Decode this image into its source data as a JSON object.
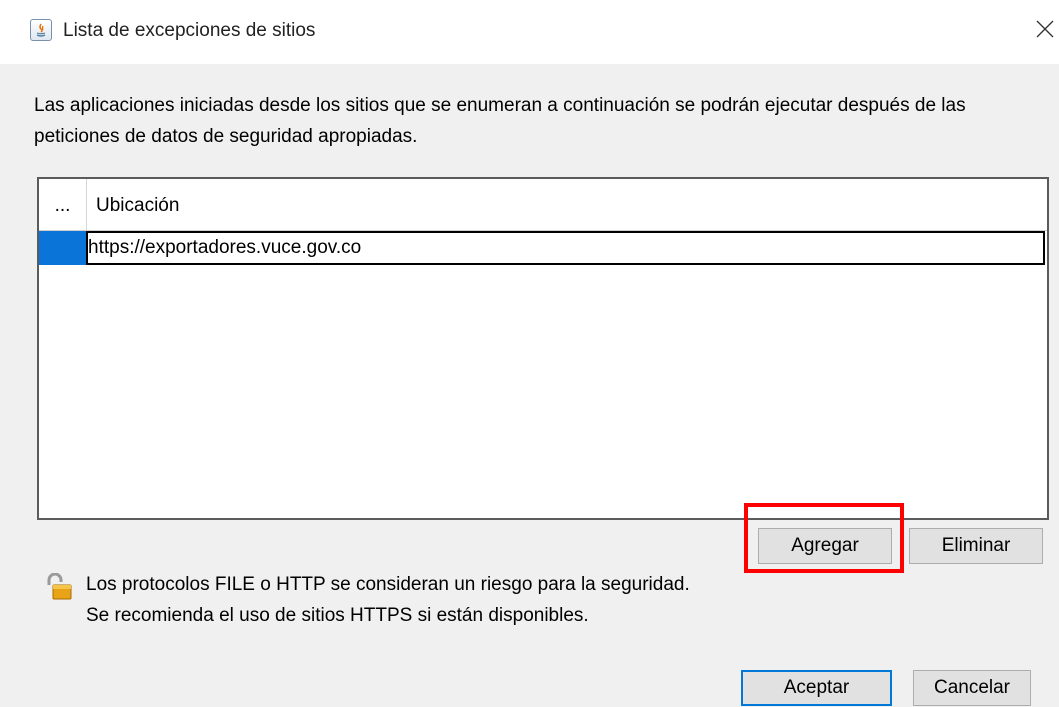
{
  "window": {
    "title": "Lista de excepciones de sitios",
    "icon": "java-icon",
    "close_icon": "close-icon"
  },
  "description": "Las aplicaciones iniciadas desde los sitios que se enumeran a continuación se podrán ejecutar después de las peticiones de datos de seguridad apropiadas.",
  "table": {
    "columns": [
      "...",
      "Ubicación"
    ],
    "rows": [
      {
        "location": "https://exportadores.vuce.gov.co",
        "selected": true,
        "editing": true
      }
    ]
  },
  "buttons": {
    "add": "Agregar",
    "remove": "Eliminar",
    "ok": "Aceptar",
    "cancel": "Cancelar"
  },
  "warning": {
    "icon": "lock-icon",
    "line1": "Los protocolos FILE o HTTP se consideran un riesgo para la seguridad.",
    "line2": "Se recomienda el uso de sitios HTTPS si están disponibles."
  },
  "colors": {
    "selection": "#0a74d9",
    "highlight": "#ff0000",
    "default_button_border": "#0078d7"
  }
}
